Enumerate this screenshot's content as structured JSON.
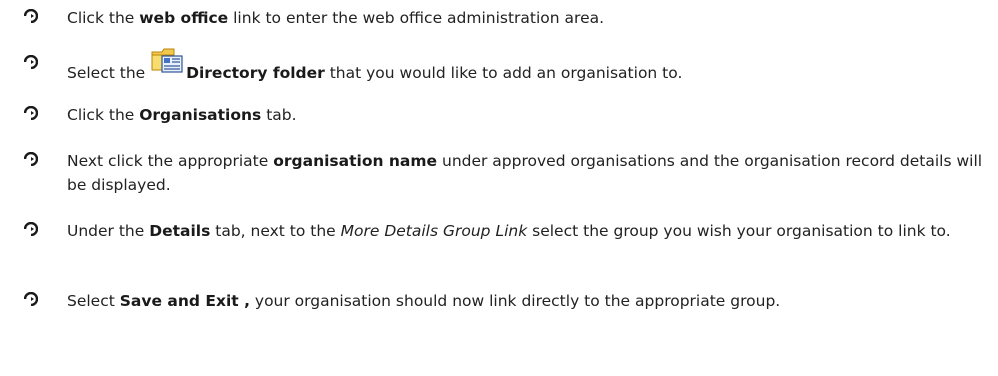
{
  "steps": [
    {
      "id": "step-1",
      "parts": [
        {
          "t": "Click the ",
          "s": "n"
        },
        {
          "t": "web office",
          "s": "b"
        },
        {
          "t": " link to enter the web office administration area.",
          "s": "n"
        }
      ]
    },
    {
      "id": "step-2",
      "parts": [
        {
          "t": "Select the ",
          "s": "n"
        },
        {
          "icon": "directory-folder-icon"
        },
        {
          "t": "Directory folder",
          "s": "b"
        },
        {
          "t": " that you would like to add an organisation to.",
          "s": "n"
        }
      ]
    },
    {
      "id": "step-3",
      "parts": [
        {
          "t": "Click the ",
          "s": "n"
        },
        {
          "t": "Organisations",
          "s": "b"
        },
        {
          "t": " tab.",
          "s": "n"
        }
      ]
    },
    {
      "id": "step-4",
      "parts": [
        {
          "t": "Next click the appropriate ",
          "s": "n"
        },
        {
          "t": "organisation name",
          "s": "b"
        },
        {
          "t": " under approved organisations and the organisation record details will be displayed.",
          "s": "n"
        }
      ]
    },
    {
      "id": "step-5",
      "parts": [
        {
          "t": "Under the ",
          "s": "n"
        },
        {
          "t": "Details",
          "s": "b"
        },
        {
          "t": " tab, next to the ",
          "s": "n"
        },
        {
          "t": "More Details Group Link",
          "s": "i"
        },
        {
          "t": " select the group you wish your organisation to link to.",
          "s": "n"
        }
      ]
    },
    {
      "id": "step-6",
      "parts": [
        {
          "t": "Select ",
          "s": "n"
        },
        {
          "t": "Save and Exit ,",
          "s": "b"
        },
        {
          "t": " your organisation should now link directly to the appropriate group.",
          "s": "n"
        }
      ]
    }
  ],
  "icons": {
    "bullet": "arrow-bullet-icon",
    "folder": "directory-folder-icon"
  }
}
